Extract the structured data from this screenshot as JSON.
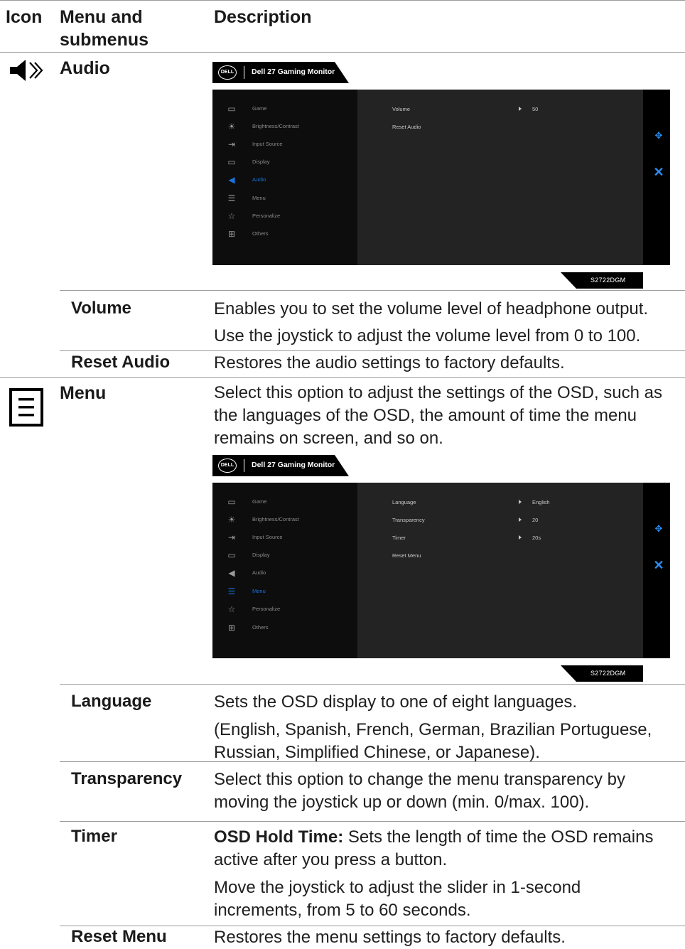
{
  "table_header": {
    "col1": "Icon",
    "col2": "Menu and submenus",
    "col3": "Description"
  },
  "audio": {
    "title": "Audio",
    "osd": {
      "monitor_title": "Dell 27 Gaming Monitor",
      "logo": "DELL",
      "menu_items": [
        "Game",
        "Brightness/Contrast",
        "Input Source",
        "Display",
        "Audio",
        "Menu",
        "Personalize",
        "Others"
      ],
      "active_index": 4,
      "settings": [
        {
          "name": "Volume",
          "value": "50"
        },
        {
          "name": "Reset Audio",
          "value": ""
        }
      ],
      "model": "S2722DGM"
    },
    "submenus": [
      {
        "name": "Volume",
        "desc": [
          "Enables you to set the volume level of headphone output.",
          "Use the joystick to adjust the volume level from 0 to 100."
        ]
      },
      {
        "name": "Reset Audio",
        "desc": [
          "Restores the audio settings to factory defaults."
        ]
      }
    ]
  },
  "menu": {
    "title": "Menu",
    "desc": "Select this option to adjust the settings of the OSD, such as the languages of the OSD, the amount of time the menu remains on screen, and so on.",
    "osd": {
      "monitor_title": "Dell 27 Gaming Monitor",
      "logo": "DELL",
      "menu_items": [
        "Game",
        "Brightness/Contrast",
        "Input Source",
        "Display",
        "Audio",
        "Menu",
        "Personalize",
        "Others"
      ],
      "active_index": 5,
      "settings": [
        {
          "name": "Language",
          "value": "English"
        },
        {
          "name": "Transparency",
          "value": "20"
        },
        {
          "name": "Timer",
          "value": "20s"
        },
        {
          "name": "Reset Menu",
          "value": ""
        }
      ],
      "model": "S2722DGM"
    },
    "submenus": [
      {
        "name": "Language",
        "desc": [
          "Sets the OSD display to one of eight languages.",
          "(English, Spanish, French, German, Brazilian Portuguese, Russian, Simplified Chinese, or Japanese)."
        ]
      },
      {
        "name": "Transparency",
        "desc": [
          "Select this option to change the menu transparency by moving the joystick up or down (min. 0/max. 100)."
        ]
      },
      {
        "name": "Timer",
        "desc_bold": "OSD Hold Time:",
        "desc": [
          " Sets the length of time the OSD remains active after you press a button.",
          "Move the joystick to adjust the slider in 1-second increments, from 5 to 60 seconds."
        ]
      },
      {
        "name": "Reset Menu",
        "desc": [
          "Restores the menu settings to factory defaults."
        ]
      }
    ]
  },
  "icons": {
    "audio": "speaker-icon",
    "menu": "menu-list-icon"
  }
}
